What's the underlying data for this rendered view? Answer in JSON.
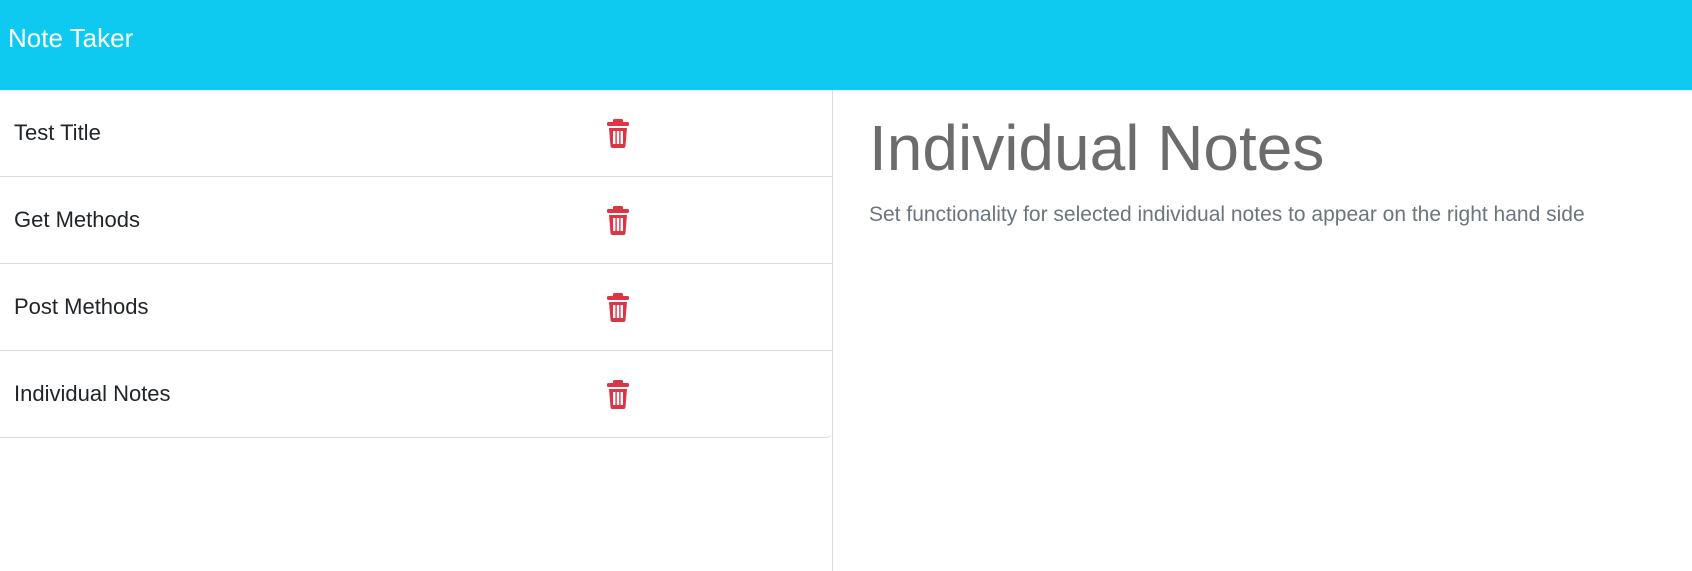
{
  "header": {
    "brand": "Note Taker"
  },
  "notes": [
    {
      "title": "Test Title",
      "delete_icon": "trash-icon"
    },
    {
      "title": "Get Methods",
      "delete_icon": "trash-icon"
    },
    {
      "title": "Post Methods",
      "delete_icon": "trash-icon"
    },
    {
      "title": "Individual Notes",
      "delete_icon": "trash-icon"
    }
  ],
  "detail": {
    "title": "Individual Notes",
    "text": "Set functionality for selected individual notes to appear on the right hand side"
  },
  "colors": {
    "navbar": "#0fcaf0",
    "delete": "#dc3545",
    "detail_text": "#6c757d"
  }
}
